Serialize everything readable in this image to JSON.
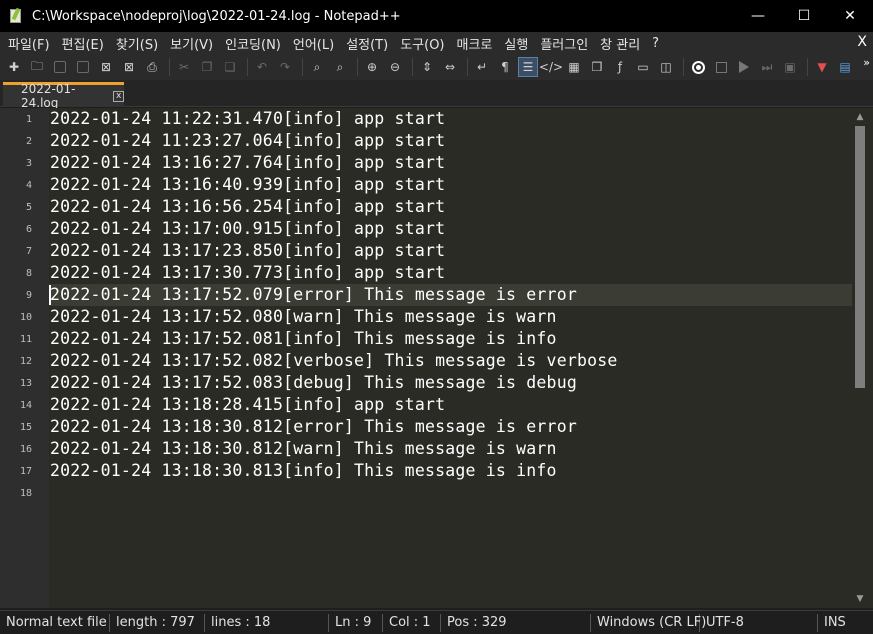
{
  "window": {
    "title": "C:\\Workspace\\nodeproj\\log\\2022-01-24.log - Notepad++",
    "minimize": "—",
    "maximize": "☐",
    "close": "✕"
  },
  "menu": {
    "items": [
      "파일(F)",
      "편집(E)",
      "찾기(S)",
      "보기(V)",
      "인코딩(N)",
      "언어(L)",
      "설정(T)",
      "도구(O)",
      "매크로",
      "실행",
      "플러그인",
      "창 관리",
      "?"
    ],
    "close_label": "X"
  },
  "toolbar": {
    "icons": [
      "new-file-icon",
      "open-folder-icon",
      "save-icon",
      "save-all-icon",
      "close-icon",
      "close-all-icon",
      "print-icon",
      "cut-icon",
      "copy-icon",
      "paste-icon",
      "undo-icon",
      "redo-icon",
      "find-icon",
      "replace-icon",
      "zoom-in-icon",
      "zoom-out-icon",
      "sync-vertical-icon",
      "sync-horizontal-icon",
      "word-wrap-icon",
      "show-all-chars-icon",
      "indent-guide-icon",
      "xml-icon",
      "document-map-icon",
      "doc-list-icon",
      "function-list-icon",
      "monitor-icon",
      "screenshot-icon",
      "record-macro-icon",
      "stop-record-icon",
      "play-macro-icon",
      "play-multiple-icon",
      "save-macro-icon",
      "panel-icon",
      "plugin-icon"
    ]
  },
  "tab": {
    "label": "2022-01-24.log",
    "close": "x"
  },
  "editor": {
    "current_line": 9,
    "lines": [
      {
        "num": "1",
        "text": "2022-01-24 11:22:31.470[info] app start"
      },
      {
        "num": "2",
        "text": "2022-01-24 11:23:27.064[info] app start"
      },
      {
        "num": "3",
        "text": "2022-01-24 13:16:27.764[info] app start"
      },
      {
        "num": "4",
        "text": "2022-01-24 13:16:40.939[info] app start"
      },
      {
        "num": "5",
        "text": "2022-01-24 13:16:56.254[info] app start"
      },
      {
        "num": "6",
        "text": "2022-01-24 13:17:00.915[info] app start"
      },
      {
        "num": "7",
        "text": "2022-01-24 13:17:23.850[info] app start"
      },
      {
        "num": "8",
        "text": "2022-01-24 13:17:30.773[info] app start"
      },
      {
        "num": "9",
        "text": "2022-01-24 13:17:52.079[error] This message is error"
      },
      {
        "num": "10",
        "text": "2022-01-24 13:17:52.080[warn] This message is warn"
      },
      {
        "num": "11",
        "text": "2022-01-24 13:17:52.081[info] This message is info"
      },
      {
        "num": "12",
        "text": "2022-01-24 13:17:52.082[verbose] This message is verbose"
      },
      {
        "num": "13",
        "text": "2022-01-24 13:17:52.083[debug] This message is debug"
      },
      {
        "num": "14",
        "text": "2022-01-24 13:18:28.415[info] app start"
      },
      {
        "num": "15",
        "text": "2022-01-24 13:18:30.812[error] This message is error"
      },
      {
        "num": "16",
        "text": "2022-01-24 13:18:30.812[warn] This message is warn"
      },
      {
        "num": "17",
        "text": "2022-01-24 13:18:30.813[info] This message is info"
      },
      {
        "num": "18",
        "text": ""
      }
    ]
  },
  "status": {
    "file_type": "Normal text file",
    "length": "length : 797",
    "lines": "lines : 18",
    "ln": "Ln : 9",
    "col": "Col : 1",
    "pos": "Pos : 329",
    "eol": "Windows (CR LF)",
    "encoding": "UTF-8",
    "mode": "INS"
  },
  "colors": {
    "editor_bg": "#2a2b24",
    "current_line_bg": "#3b3c33",
    "tab_accent": "#f0a030"
  }
}
